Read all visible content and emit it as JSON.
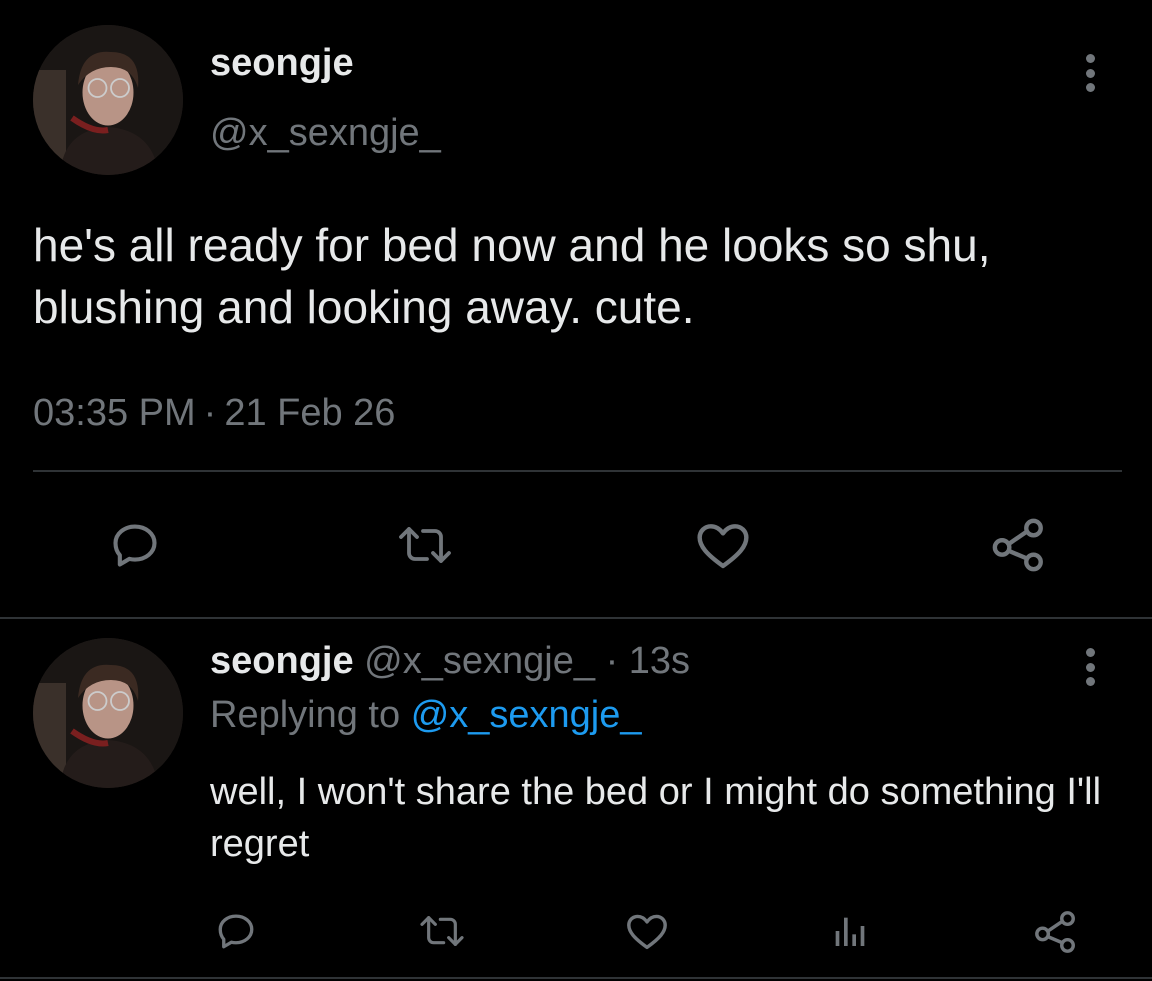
{
  "main_tweet": {
    "name": "seongje",
    "handle": "@x_sexngje_",
    "text": "he's all ready for bed now and he looks so shu, blushing and looking away. cute.",
    "time": "03:35 PM",
    "separator": "·",
    "date": "21 Feb 26",
    "actions": [
      "reply-icon",
      "retweet-icon",
      "like-icon",
      "share-icon"
    ]
  },
  "reply_tweet": {
    "name": "seongje",
    "handle": "@x_sexngje_",
    "dot": "·",
    "time": "13s",
    "replying_prefix": "Replying to",
    "replying_to": "@x_sexngje_",
    "text": "well, I won't share the bed or I might do something I'll regret",
    "actions": [
      "reply-icon",
      "retweet-icon",
      "like-icon",
      "analytics-icon",
      "share-icon"
    ]
  },
  "colors": {
    "background": "#000000",
    "text": "#e7e9ea",
    "muted": "#71767b",
    "link": "#1d9bf0",
    "divider": "#2f3336"
  }
}
